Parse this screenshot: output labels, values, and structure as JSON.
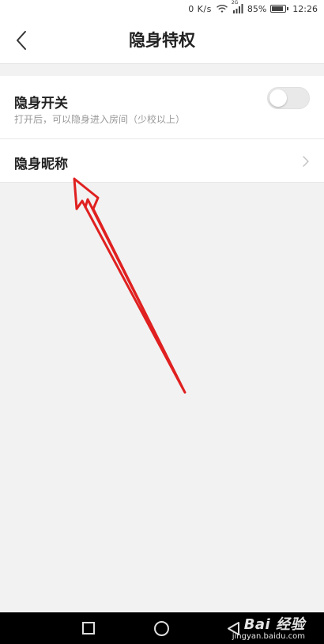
{
  "status_bar": {
    "speed": "0 K/s",
    "network": "2G",
    "battery": "85%",
    "battery_level": 0.85,
    "time": "12:26"
  },
  "header": {
    "back_icon": "chevron-left-icon",
    "title": "隐身特权"
  },
  "settings": {
    "stealth_toggle": {
      "label": "隐身开关",
      "description": "打开后，可以隐身进入房间（少校以上）",
      "enabled": false
    },
    "stealth_nickname": {
      "label": "隐身昵称",
      "icon": "chevron-right-icon"
    }
  },
  "annotation": {
    "color": "#e02020"
  },
  "nav_bar": {
    "recent_icon": "square-icon",
    "home_icon": "circle-icon",
    "back_icon": "triangle-back-icon"
  },
  "watermark": {
    "logo": "Bai 经验",
    "url": "jingyan.baidu.com"
  }
}
